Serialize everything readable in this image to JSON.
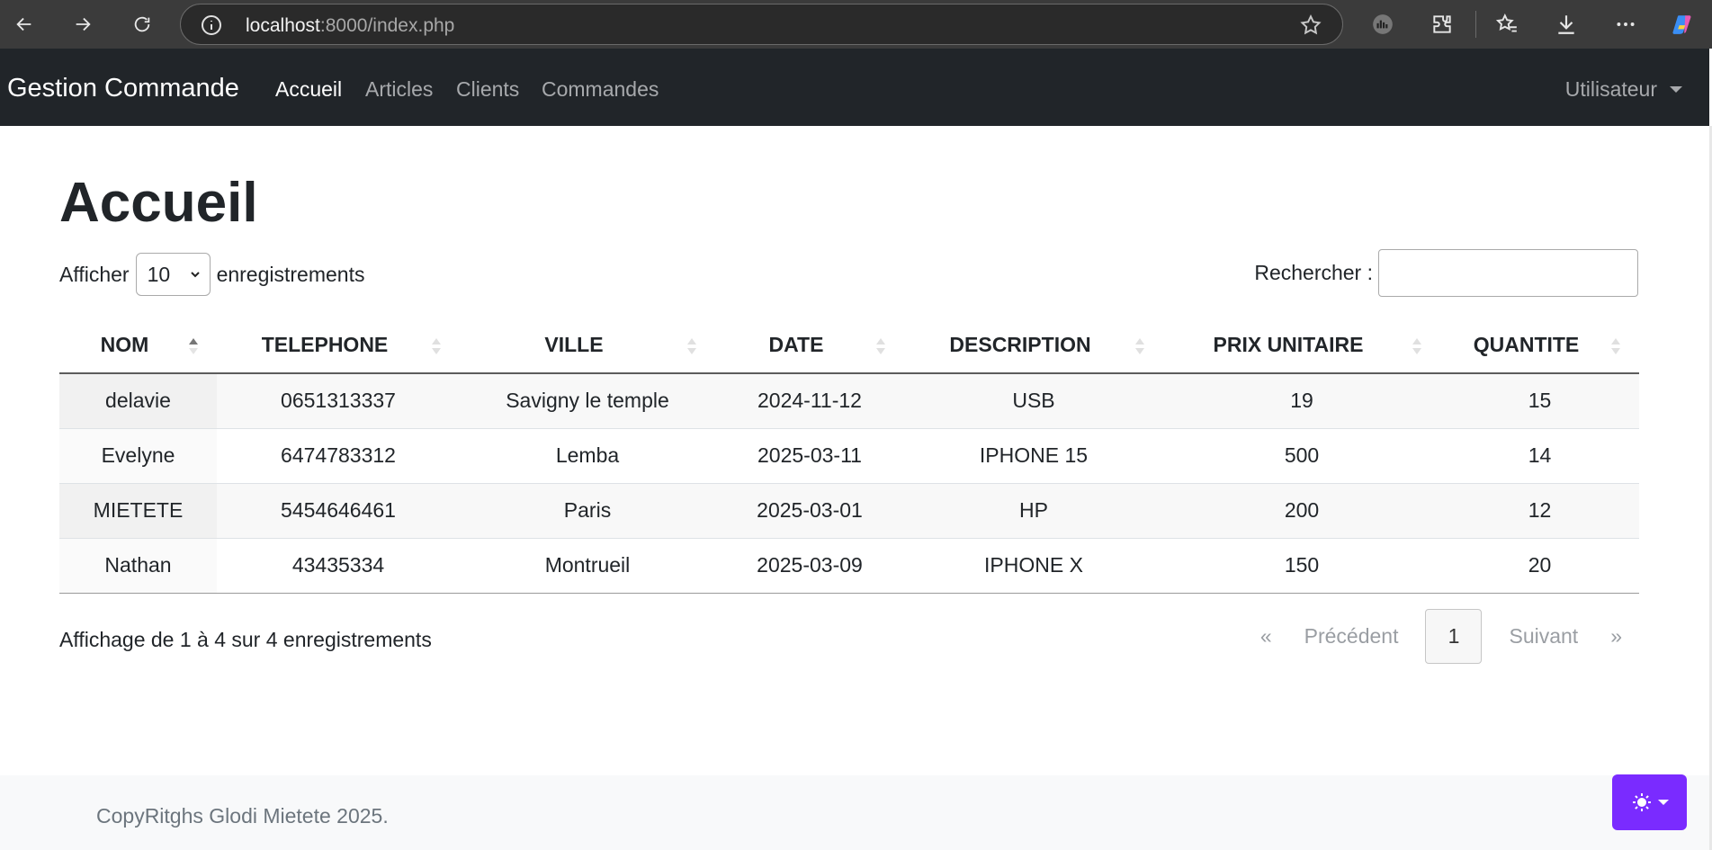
{
  "browser": {
    "url_host": "localhost",
    "url_rest": ":8000/index.php"
  },
  "navbar": {
    "brand": "Gestion Commande",
    "links": [
      "Accueil",
      "Articles",
      "Clients",
      "Commandes"
    ],
    "user": "Utilisateur"
  },
  "page": {
    "title": "Accueil",
    "length_prefix": "Afficher",
    "length_value": "10",
    "length_suffix": "enregistrements",
    "search_label": "Rechercher :",
    "search_value": ""
  },
  "table": {
    "headers": [
      "NOM",
      "TELEPHONE",
      "VILLE",
      "DATE",
      "DESCRIPTION",
      "PRIX UNITAIRE",
      "QUANTITE"
    ],
    "rows": [
      [
        "delavie",
        "0651313337",
        "Savigny le temple",
        "2024-11-12",
        "USB",
        "19",
        "15"
      ],
      [
        "Evelyne",
        "6474783312",
        "Lemba",
        "2025-03-11",
        "IPHONE 15",
        "500",
        "14"
      ],
      [
        "MIETETE",
        "5454646461",
        "Paris",
        "2025-03-01",
        "HP",
        "200",
        "12"
      ],
      [
        "Nathan",
        "43435334",
        "Montrueil",
        "2025-03-09",
        "IPHONE X",
        "150",
        "20"
      ]
    ]
  },
  "info": "Affichage de 1 à 4 sur 4 enregistrements",
  "pagination": {
    "first": "«",
    "prev": "Précédent",
    "current": "1",
    "next": "Suivant",
    "last": "»"
  },
  "footer": {
    "text": "CopyRitghs Glodi Mietete 2025."
  },
  "colors": {
    "navbar_bg": "#212529",
    "theme_button": "#7a2bff"
  }
}
